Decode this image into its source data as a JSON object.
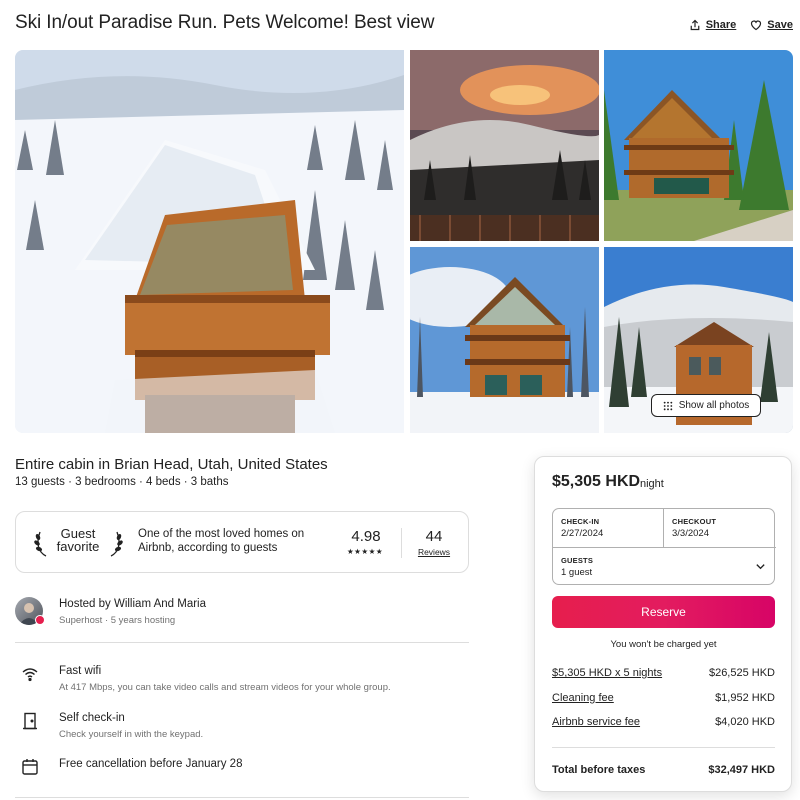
{
  "header": {
    "title": "Ski In/out Paradise Run. Pets Welcome! Best view",
    "share_label": "Share",
    "save_label": "Save"
  },
  "gallery": {
    "show_all_label": "Show all photos"
  },
  "listing": {
    "type": "Entire cabin in Brian Head, Utah, United States",
    "specs": "13 guests · 3 bedrooms · 4 beds · 3 baths"
  },
  "guest_favorite": {
    "label_line1": "Guest",
    "label_line2": "favorite",
    "description": "One of the most loved homes on Airbnb, according to guests",
    "rating": "4.98",
    "stars": "★★★★★",
    "reviews_count": "44",
    "reviews_label": "Reviews"
  },
  "host": {
    "name": "Hosted by William And Maria",
    "subtitle": "Superhost · 5 years hosting"
  },
  "amenities": [
    {
      "icon": "wifi-icon",
      "title": "Fast wifi",
      "subtitle": "At 417 Mbps, you can take video calls and stream videos for your whole group."
    },
    {
      "icon": "door-icon",
      "title": "Self check-in",
      "subtitle": "Check yourself in with the keypad."
    },
    {
      "icon": "calendar-icon",
      "title": "Free cancellation before January 28",
      "subtitle": ""
    }
  ],
  "booking": {
    "price": "$5,305 HKD",
    "price_unit": "night",
    "checkin_label": "CHECK-IN",
    "checkin_value": "2/27/2024",
    "checkout_label": "CHECKOUT",
    "checkout_value": "3/3/2024",
    "guests_label": "GUESTS",
    "guests_value": "1 guest",
    "reserve_label": "Reserve",
    "no_charge_note": "You won't be charged yet",
    "fees": [
      {
        "label": "$5,305 HKD x 5 nights",
        "amount": "$26,525 HKD"
      },
      {
        "label": "Cleaning fee",
        "amount": "$1,952 HKD"
      },
      {
        "label": "Airbnb service fee",
        "amount": "$4,020 HKD"
      }
    ],
    "total_label": "Total before taxes",
    "total_amount": "$32,497 HKD"
  },
  "colors": {
    "brand": "#e61e4d",
    "text": "#222222",
    "muted": "#717171",
    "border": "#dddddd"
  }
}
